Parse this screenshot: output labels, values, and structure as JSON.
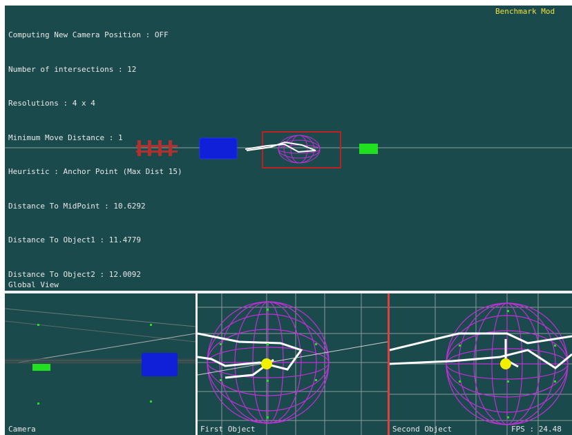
{
  "global_view": {
    "hud_lines": [
      "Computing New Camera Position : OFF",
      "Number of intersections : 12",
      "Resolutions : 4 x 4",
      "Minimum Move Distance : 1",
      "Heuristic : Anchor Point (Max Dist 15)",
      "Distance To MidPoint : 10.6292",
      "Distance To Object1 : 11.4779",
      "Distance To Object2 : 12.0092"
    ],
    "mode_label": "Benchmark Mod",
    "view_label": "Global View"
  },
  "camera_view": {
    "label": "Camera"
  },
  "first_view": {
    "label": "First Object"
  },
  "second_view": {
    "label": "Second Object",
    "fps_label": "FPS : 24.48"
  },
  "colors": {
    "background": "#1b4a4d",
    "mode_label": "#f0e040",
    "object_blue": "#1020d8",
    "object_green": "#20e020",
    "object_magenta": "#c030d8",
    "fence_red": "#b03030",
    "selection_red": "#c02020",
    "marker_yellow": "#f0f000"
  }
}
